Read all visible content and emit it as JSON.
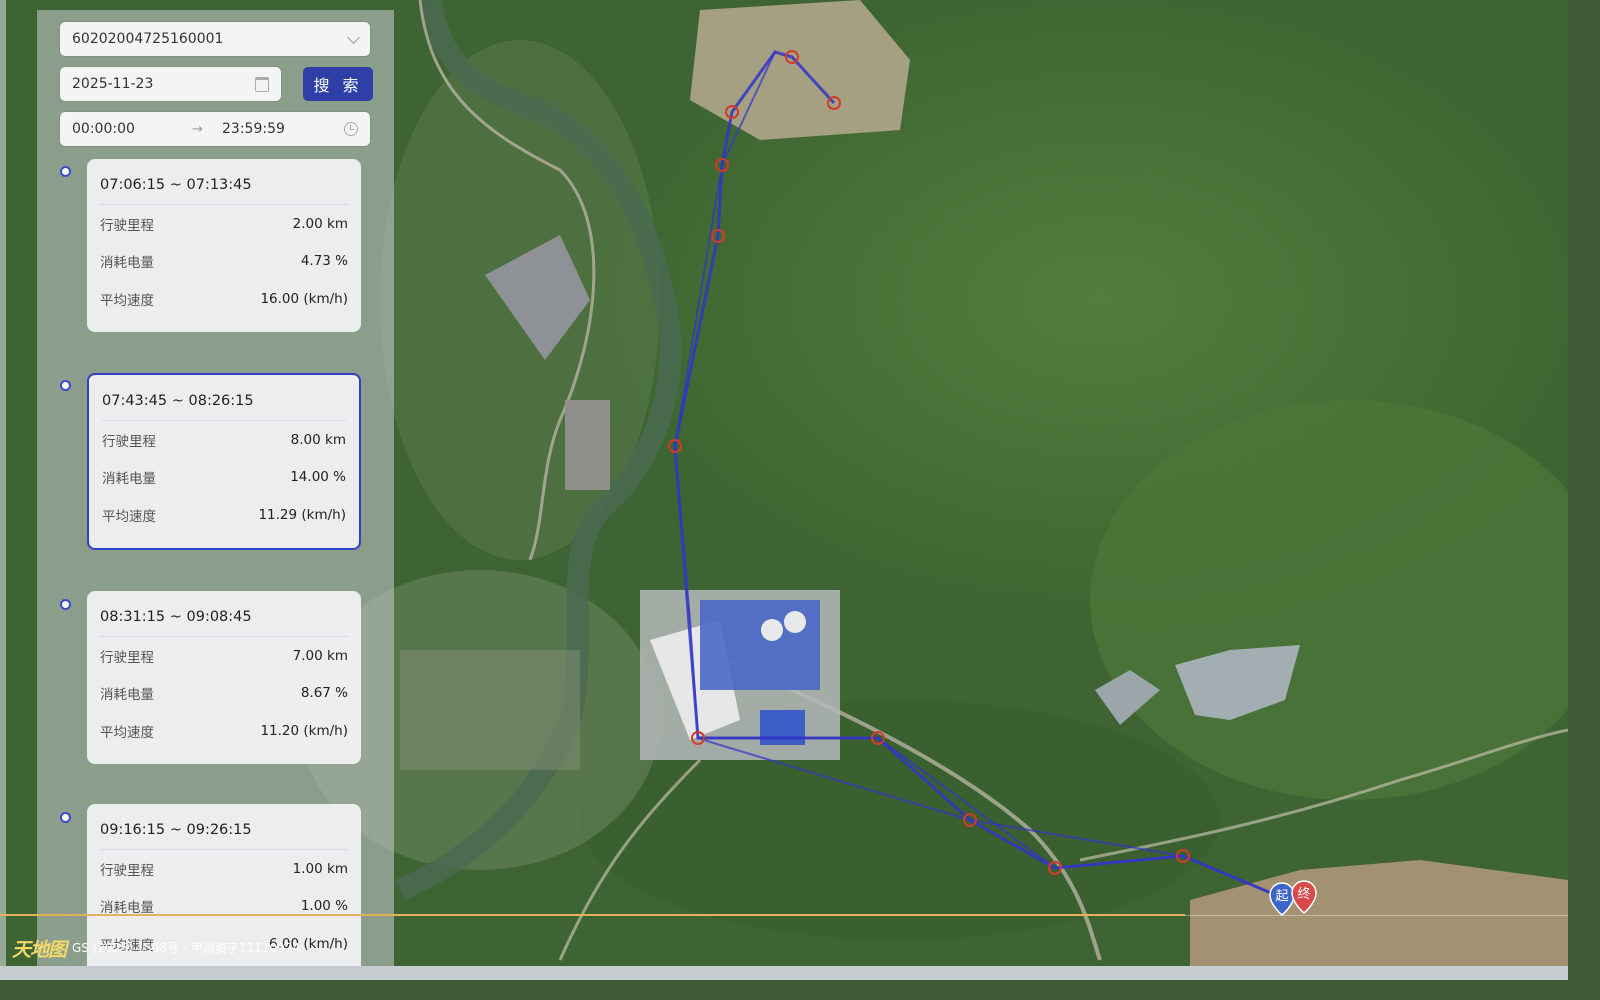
{
  "device_select": {
    "value": "60202004725160001"
  },
  "date_field": {
    "value": "2025-11-23"
  },
  "search_button": {
    "label": "搜 索"
  },
  "time_range": {
    "start": "00:00:00",
    "separator": "→",
    "end": "23:59:59"
  },
  "trips": [
    {
      "time": "07:06:15 ~ 07:13:45",
      "rows": [
        {
          "label": "行驶里程",
          "value": "2.00 km"
        },
        {
          "label": "消耗电量",
          "value": "4.73 %"
        },
        {
          "label": "平均速度",
          "value": "16.00 (km/h)"
        }
      ]
    },
    {
      "time": "07:43:45 ~ 08:26:15",
      "selected": true,
      "rows": [
        {
          "label": "行驶里程",
          "value": "8.00 km"
        },
        {
          "label": "消耗电量",
          "value": "14.00 %"
        },
        {
          "label": "平均速度",
          "value": "11.29 (km/h)"
        }
      ]
    },
    {
      "time": "08:31:15 ~ 09:08:45",
      "rows": [
        {
          "label": "行驶里程",
          "value": "7.00 km"
        },
        {
          "label": "消耗电量",
          "value": "8.67 %"
        },
        {
          "label": "平均速度",
          "value": "11.20 (km/h)"
        }
      ]
    },
    {
      "time": "09:16:15 ~ 09:26:15",
      "rows": [
        {
          "label": "行驶里程",
          "value": "1.00 km"
        },
        {
          "label": "消耗电量",
          "value": "1.00 %"
        },
        {
          "label": "平均速度",
          "value": "6.00 (km/h)"
        }
      ]
    }
  ],
  "map": {
    "start_marker": "起",
    "end_marker": "终",
    "logo_text": "天地图",
    "attribution": "GS (2025) 1508号 - 甲测资字11110974",
    "route_color": "#3335c8",
    "point_color": "#d23a2a"
  }
}
